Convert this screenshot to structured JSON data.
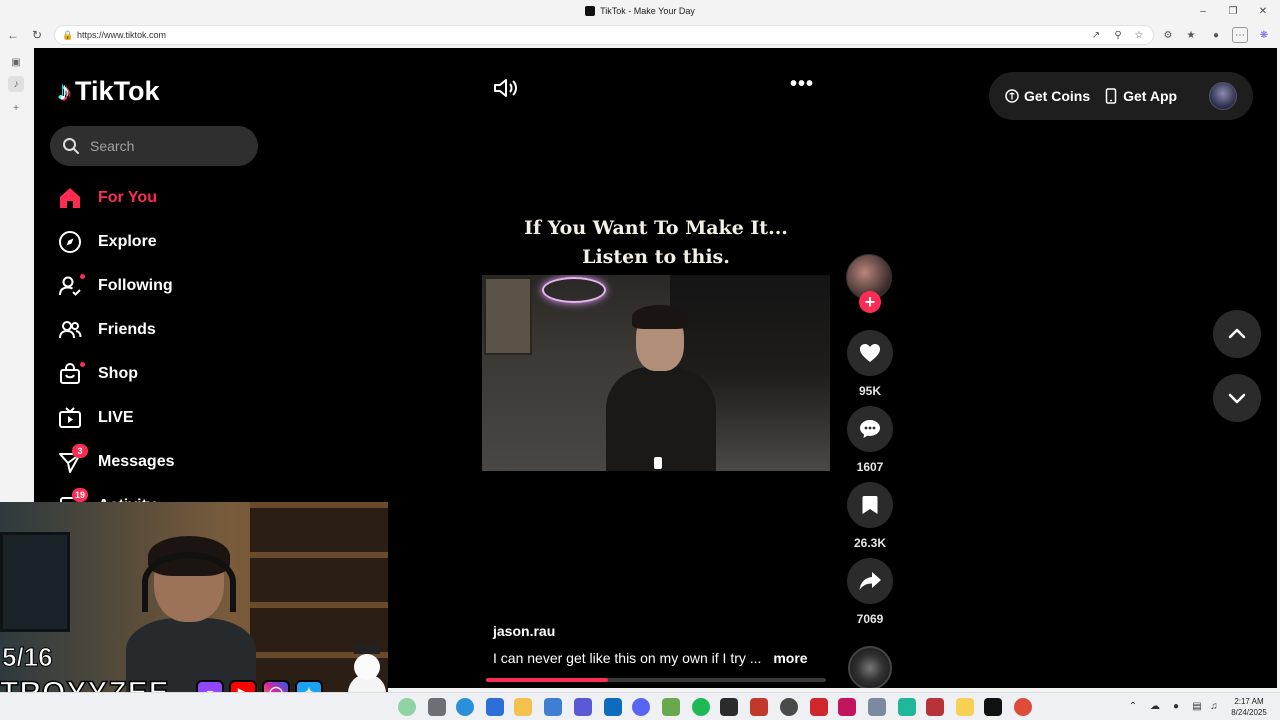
{
  "browser": {
    "window_title": "TikTok - Make Your Day",
    "url": "https://www.tiktok.com"
  },
  "sidebar": {
    "logo": "TikTok",
    "search_placeholder": "Search",
    "items": [
      {
        "label": "For You",
        "icon": "home-icon",
        "active": true
      },
      {
        "label": "Explore",
        "icon": "compass-icon"
      },
      {
        "label": "Following",
        "icon": "following-icon",
        "dot": true
      },
      {
        "label": "Friends",
        "icon": "friends-icon"
      },
      {
        "label": "Shop",
        "icon": "shop-icon",
        "dot": true
      },
      {
        "label": "LIVE",
        "icon": "live-icon"
      },
      {
        "label": "Messages",
        "icon": "messages-icon",
        "badge": "3"
      },
      {
        "label": "Activity",
        "icon": "activity-icon",
        "badge": "19"
      }
    ]
  },
  "topbar": {
    "get_coins": "Get Coins",
    "get_app": "Get App"
  },
  "video": {
    "title_line1": "If You Want To Make It...",
    "title_line2": "Listen to this.",
    "author": "jason.rau",
    "caption": "I can never get like this on my own if I try ...",
    "more": "more",
    "progress": 0.36
  },
  "actions": {
    "likes": "95K",
    "comments": "1607",
    "saves": "26.3K",
    "shares": "7069"
  },
  "stream_overlay": {
    "counter": "5/16",
    "handle": "TROYYZEE"
  },
  "taskbar": {
    "time": "2:17 AM",
    "date": "8/24/2025"
  },
  "colors": {
    "accent": "#fe2c55",
    "page_bg": "#000000",
    "button_bg": "#2b2b2b"
  }
}
